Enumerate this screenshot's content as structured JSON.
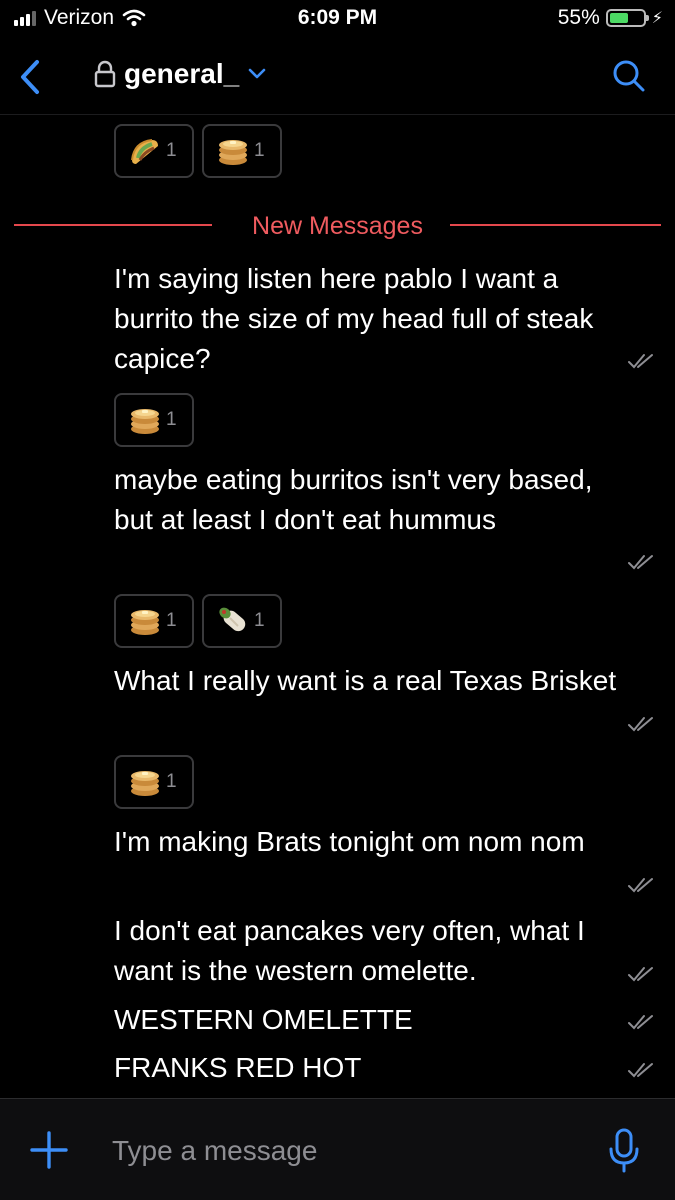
{
  "status_bar": {
    "carrier": "Verizon",
    "time": "6:09 PM",
    "battery": "55%",
    "battery_level": 0.55
  },
  "header": {
    "channel_name": "general_"
  },
  "colors": {
    "accent": "#3d8ef7",
    "new_messages": "#e5484d",
    "reaction_border": "#3a3a3c"
  },
  "divider": {
    "label": "New Messages"
  },
  "messages": [
    {
      "text": "I'm saying listen here pablo I want a burrito the size of my head full of steak capice?"
    },
    {
      "text": "maybe eating burritos isn't very based, but at least I don't eat hummus"
    },
    {
      "text": "What I really want is a real Texas Brisket"
    },
    {
      "text": "I'm making Brats tonight om nom nom"
    },
    {
      "text": "I don't eat pancakes very often, what I want is the western omelette."
    },
    {
      "text": "WESTERN OMELETTE"
    },
    {
      "text": "FRANKS RED HOT"
    }
  ],
  "reaction_rows": [
    [
      {
        "emoji": "taco-icon",
        "count": "1"
      },
      {
        "emoji": "pancakes-icon",
        "count": "1"
      }
    ],
    [
      {
        "emoji": "pancakes-icon",
        "count": "1"
      }
    ],
    [
      {
        "emoji": "pancakes-icon",
        "count": "1"
      },
      {
        "emoji": "burrito-icon",
        "count": "1"
      }
    ],
    [
      {
        "emoji": "pancakes-icon",
        "count": "1"
      }
    ]
  ],
  "composer": {
    "placeholder": "Type a message"
  }
}
